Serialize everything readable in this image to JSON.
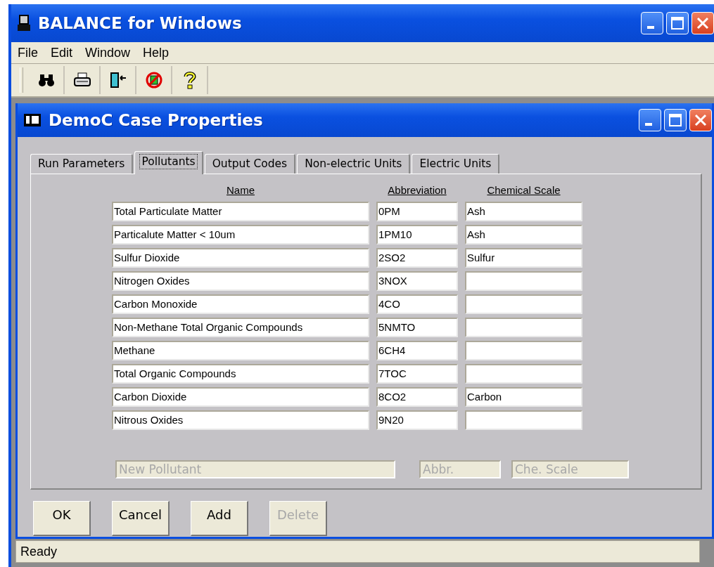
{
  "window": {
    "title": "BALANCE for Windows"
  },
  "menu": [
    "File",
    "Edit",
    "Window",
    "Help"
  ],
  "toolbar": [
    {
      "kind": "binoculars"
    },
    {
      "kind": "printer"
    },
    {
      "kind": "door"
    },
    {
      "kind": "nosign"
    },
    {
      "kind": "help"
    }
  ],
  "dialog": {
    "title": "DemoC Case Properties",
    "tabs": [
      {
        "label": "Run Parameters",
        "selected": false
      },
      {
        "label": "Pollutants",
        "selected": true
      },
      {
        "label": "Output Codes",
        "selected": false
      },
      {
        "label": "Non-electric Units",
        "selected": false
      },
      {
        "label": "Electric Units",
        "selected": false
      }
    ],
    "columns": [
      "Name",
      "Abbreviation",
      "Chemical Scale"
    ],
    "rows": [
      {
        "name": "Total Particulate Matter",
        "abbreviation": "0PM",
        "scale": "Ash"
      },
      {
        "name": "Particalute Matter < 10um",
        "abbreviation": "1PM10",
        "scale": "Ash"
      },
      {
        "name": "Sulfur Dioxide",
        "abbreviation": "2SO2",
        "scale": "Sulfur"
      },
      {
        "name": "Nitrogen Oxides",
        "abbreviation": "3NOX"
      },
      {
        "name": "Carbon Monoxide",
        "abbreviation": "4CO"
      },
      {
        "name": "Non-Methane Total Organic Compounds",
        "abbreviation": "5NMTO"
      },
      {
        "name": "Methane",
        "abbreviation": "6CH4"
      },
      {
        "name": "Total Organic Compounds",
        "abbreviation": "7TOC"
      },
      {
        "name": "Carbon Dioxide",
        "abbreviation": "8CO2",
        "scale": "Carbon"
      },
      {
        "name": "Nitrous Oxides",
        "abbreviation": "9N20"
      }
    ],
    "new_fields": [
      {
        "placeholder": "New Pollutant",
        "disabled": true
      },
      {
        "placeholder": "Abbr.",
        "disabled": true
      },
      {
        "placeholder": "Che. Scale",
        "disabled": true
      }
    ],
    "buttons": [
      {
        "label": "OK",
        "disabled": false
      },
      {
        "label": "Cancel",
        "disabled": false
      },
      {
        "label": "Add",
        "disabled": false
      },
      {
        "label": "Delete",
        "disabled": true
      }
    ]
  },
  "status_bar": "Ready"
}
